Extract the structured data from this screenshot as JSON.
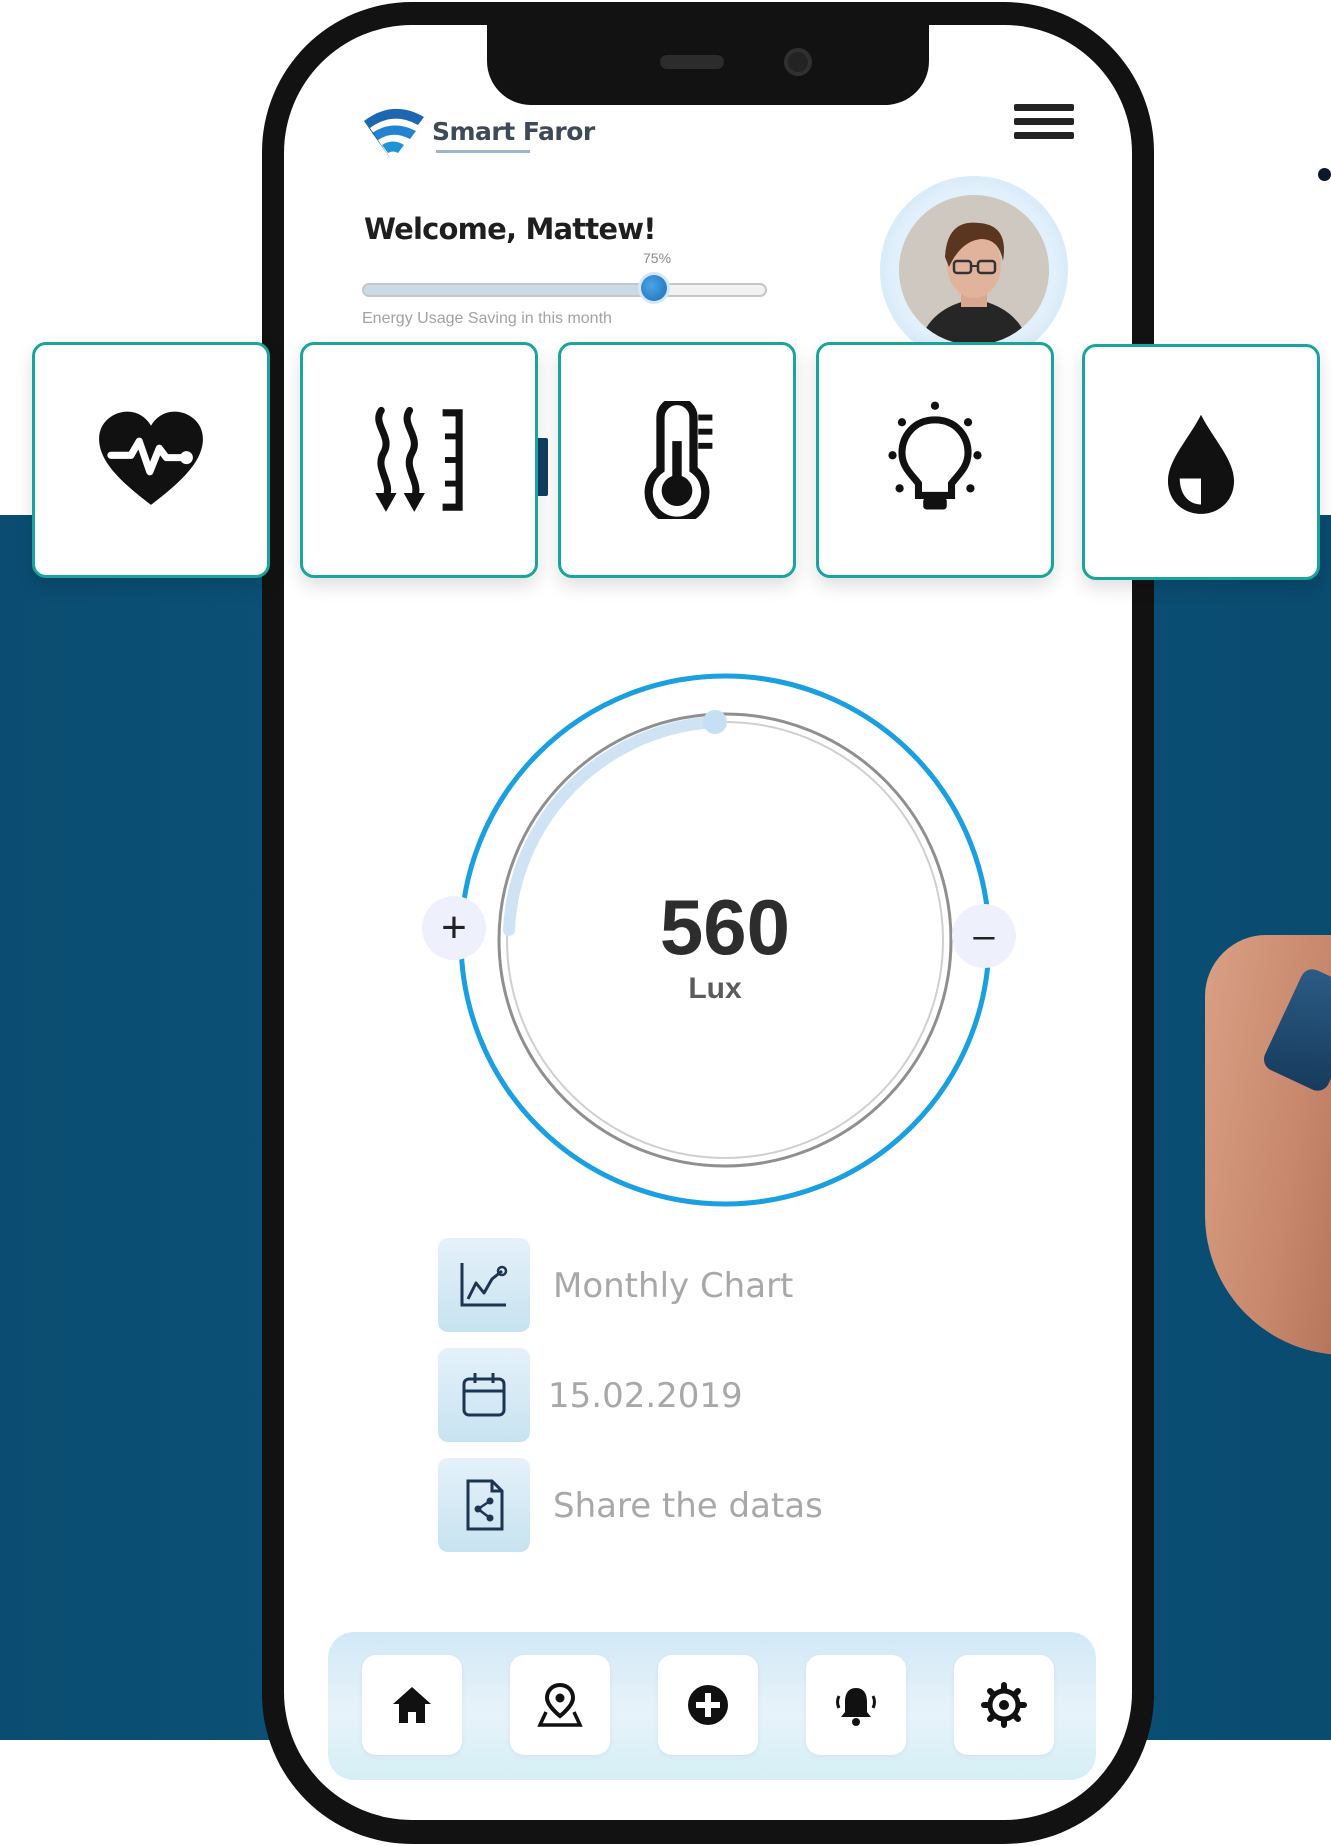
{
  "app": {
    "brand": "Smart Faror"
  },
  "header": {
    "welcome": "Welcome, Mattew!",
    "saving_percent_label": "75%",
    "saving_level": 0.72,
    "energy_caption": "Energy Usage Saving in this month",
    "menu_icon": "hamburger-menu-icon",
    "avatar_icon": "user-avatar"
  },
  "categories": [
    {
      "name": "health",
      "icon": "heart-pulse-icon"
    },
    {
      "name": "air",
      "icon": "airflow-icon"
    },
    {
      "name": "temperature",
      "icon": "thermometer-icon"
    },
    {
      "name": "light",
      "icon": "lightbulb-icon"
    },
    {
      "name": "humidity",
      "icon": "water-drop-icon"
    }
  ],
  "gauge": {
    "value": "560",
    "unit": "Lux",
    "plus": "+",
    "minus": "–",
    "level": 0.3
  },
  "menu_items": [
    {
      "label": "Monthly Chart",
      "icon": "chart-icon"
    },
    {
      "label": "15.02.2019",
      "icon": "calendar-icon"
    },
    {
      "label": "Share the datas",
      "icon": "share-document-icon"
    }
  ],
  "bottom_nav": [
    {
      "name": "home",
      "icon": "home-icon"
    },
    {
      "name": "location",
      "icon": "map-pin-icon"
    },
    {
      "name": "add",
      "icon": "add-circle-icon"
    },
    {
      "name": "notifications",
      "icon": "bell-icon"
    },
    {
      "name": "settings",
      "icon": "gear-icon"
    }
  ],
  "colors": {
    "background_band": "#0b4d72",
    "accent": "#1a9fe0",
    "card_border": "#19a49e"
  }
}
